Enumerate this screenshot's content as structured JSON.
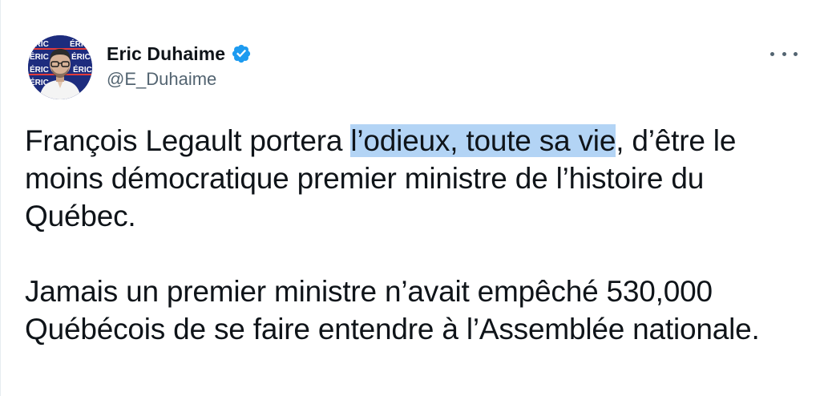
{
  "author": {
    "name": "Eric Duhaime",
    "handle": "@E_Duhaime",
    "verified": true,
    "avatar_backdrop_text": "ÉRIC"
  },
  "icons": {
    "verified": "verified-badge-icon",
    "more": "more-options-icon"
  },
  "colors": {
    "verified_blue": "#1d9bf0",
    "selection_highlight": "#b3d4f5",
    "text": "#0f1419",
    "secondary_text": "#536471"
  },
  "tweet": {
    "p1_before": "François Legault portera ",
    "p1_highlight": "l’odieux, toute sa vie",
    "p1_after": ", d’être le moins démocratique premier ministre de l’histoire du Québec.",
    "p2": "Jamais un premier ministre n’avait empêché 530,000 Québécois de se faire entendre à l’Assemblée nationale."
  }
}
